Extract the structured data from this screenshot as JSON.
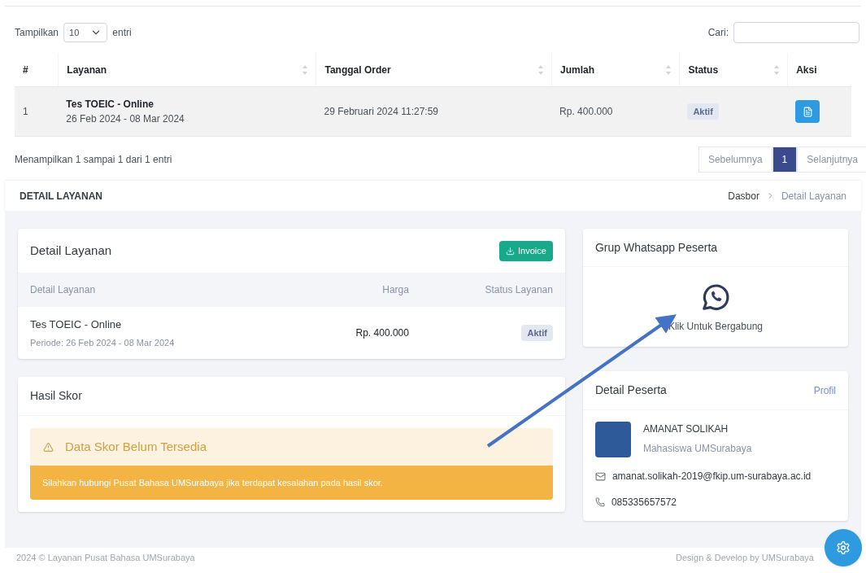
{
  "table_controls": {
    "show_label": "Tampilkan",
    "page_size": "10",
    "entries_label": "entri",
    "search_label": "Cari:"
  },
  "table": {
    "columns": [
      {
        "label": "#",
        "sortable": false
      },
      {
        "label": "Layanan",
        "sortable": true
      },
      {
        "label": "Tanggal Order",
        "sortable": true
      },
      {
        "label": "Jumlah",
        "sortable": true
      },
      {
        "label": "Status",
        "sortable": true
      },
      {
        "label": "Aksi",
        "sortable": false
      }
    ],
    "rows": [
      {
        "no": "1",
        "service": "Tes TOEIC - Online",
        "period": "26 Feb 2024 - 08 Mar 2024",
        "order_date": "29 Februari 2024 11:27:59",
        "amount": "Rp. 400.000",
        "status": "Aktif"
      }
    ]
  },
  "table_info": "Menampilkan 1 sampai 1 dari 1 entri",
  "pagination": [
    {
      "label": "Sebelumnya",
      "selected": false
    },
    {
      "label": "1",
      "selected": true
    },
    {
      "label": "Selanjutnya",
      "selected": false
    }
  ],
  "page_header": {
    "title": "DETAIL LAYANAN",
    "breadcrumbs": [
      "Dasbor",
      "Detail Layanan"
    ]
  },
  "service_card": {
    "title": "Detail Layanan",
    "button": "Invoice",
    "columns": [
      "Detail Layanan",
      "Harga",
      "Status Layanan"
    ],
    "item": {
      "name": "Tes TOEIC - Online",
      "period": "Periode: 26 Feb 2024 - 08 Mar 2024",
      "price": "Rp. 400.000",
      "status": "Aktif"
    }
  },
  "score_card": {
    "title": "Hasil Skor",
    "alert_title": "Data Skor Belum Tersedia",
    "alert_message": "Silahkan hubungi Pusat Bahasa UMSurabaya jika terdapat kesalahan pada hasil skor."
  },
  "whatsapp_card": {
    "title": "Grup Whatsapp Peserta",
    "link": "Klik Untuk Bergabung"
  },
  "participant_card": {
    "title": "Detail Peserta",
    "link": "Profil",
    "name": "AMANAT SOLIKAH",
    "role": "Mahasiswa UMSurabaya",
    "email": "amanat.solikah-2019@fkip.um-surabaya.ac.id",
    "phone": "085335657572"
  },
  "footer": {
    "left": "2024 © Layanan Pusat Bahasa UMSurabaya",
    "right": "Design & Develop by UMSurabaya"
  }
}
